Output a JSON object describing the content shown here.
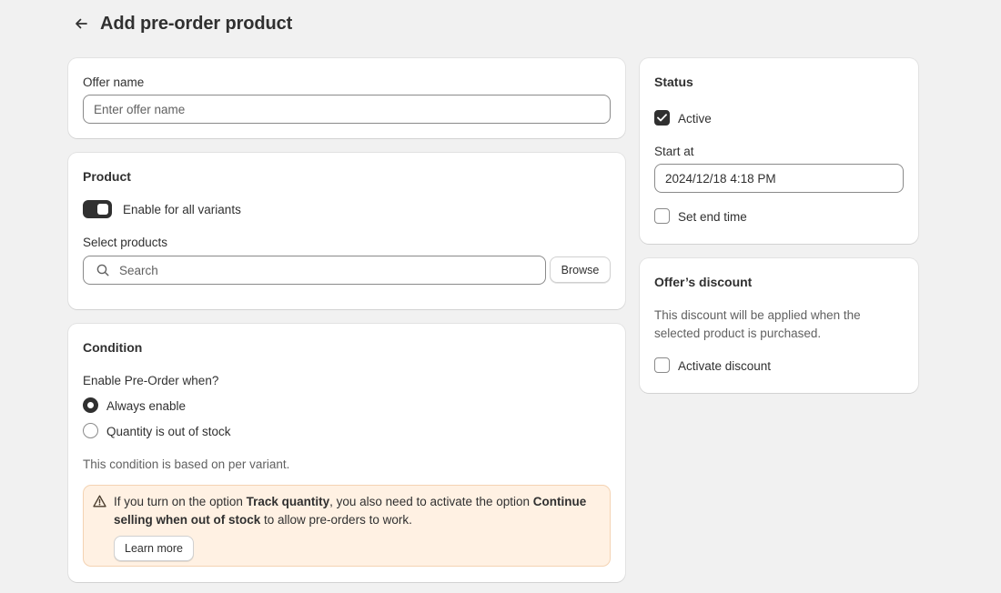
{
  "header": {
    "title": "Add pre-order product"
  },
  "offer": {
    "label": "Offer name",
    "placeholder": "Enter offer name"
  },
  "product": {
    "title": "Product",
    "toggle_label": "Enable for all variants",
    "toggle_on": true,
    "select_label": "Select products",
    "search_placeholder": "Search",
    "browse_label": "Browse"
  },
  "condition": {
    "title": "Condition",
    "question": "Enable Pre-Order when?",
    "options": [
      {
        "label": "Always enable",
        "selected": true
      },
      {
        "label": "Quantity is out of stock",
        "selected": false
      }
    ],
    "note": "This condition is based on per variant.",
    "banner": {
      "text_1": "If you turn on the option ",
      "bold_1": "Track quantity",
      "text_2": ", you also need to activate the option ",
      "bold_2": "Continue selling when out of stock",
      "text_3": " to allow pre-orders to work.",
      "button": "Learn more"
    }
  },
  "status": {
    "title": "Status",
    "active_label": "Active",
    "active_checked": true,
    "start_label": "Start at",
    "start_value": "2024/12/18 4:18 PM",
    "end_label": "Set end time",
    "end_checked": false
  },
  "discount": {
    "title": "Offer’s discount",
    "description": "This discount will be applied when the selected product is purchased.",
    "checkbox_label": "Activate discount",
    "checked": false
  },
  "colors": {
    "ink": "#303030",
    "banner_bg": "#fff1e3",
    "page_bg": "#f1f1f1"
  }
}
